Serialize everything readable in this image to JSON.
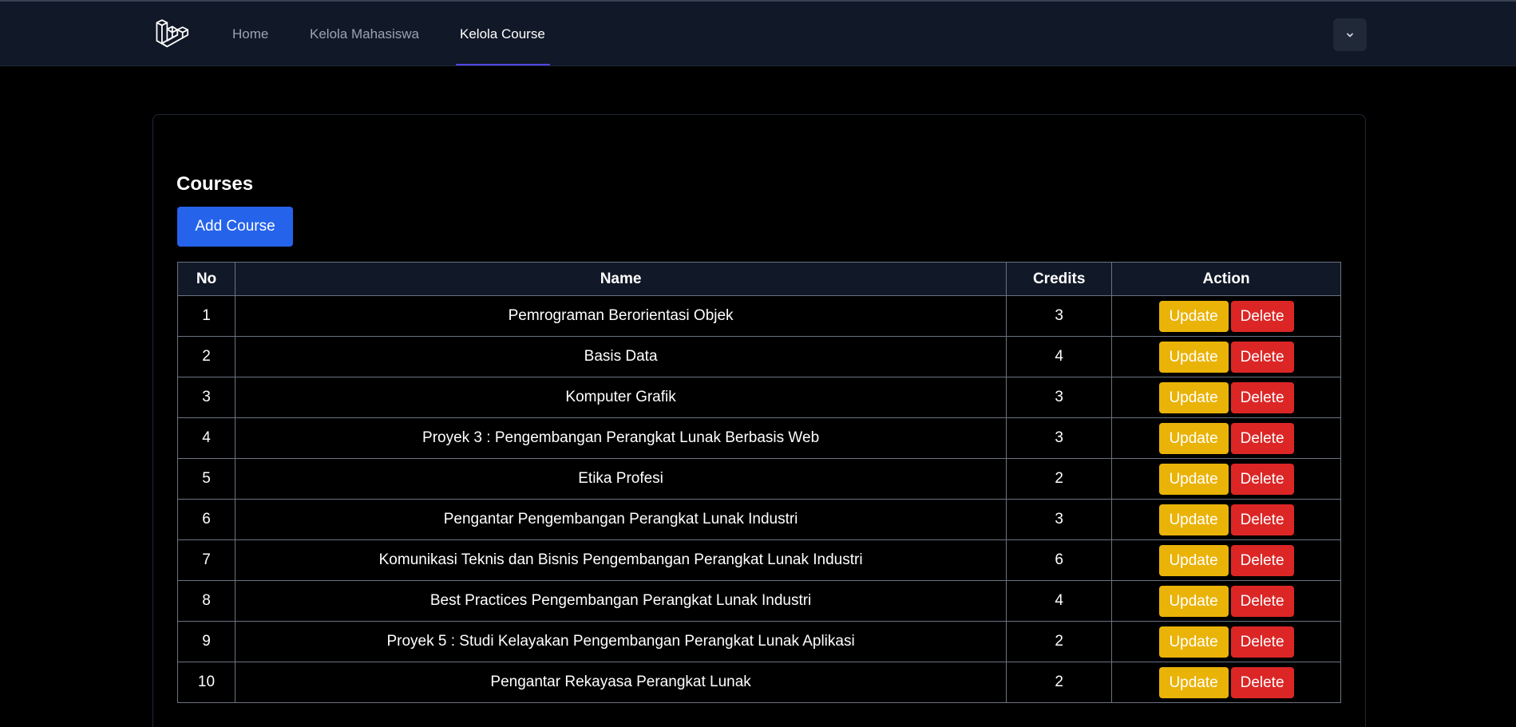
{
  "nav": {
    "logo_icon": "laravel-logo-icon",
    "links": [
      {
        "label": "Home",
        "active": false
      },
      {
        "label": "Kelola Mahasiswa",
        "active": false
      },
      {
        "label": "Kelola Course",
        "active": true
      }
    ],
    "dropdown_icon": "chevron-down-icon",
    "colors": {
      "background": "#111827",
      "active_underline": "#4f46e5"
    }
  },
  "page": {
    "title": "Courses",
    "add_button_label": "Add Course"
  },
  "table": {
    "headers": [
      "No",
      "Name",
      "Credits",
      "Action"
    ],
    "rows": [
      {
        "no": "1",
        "name": "Pemrograman Berorientasi Objek",
        "credits": "3"
      },
      {
        "no": "2",
        "name": "Basis Data",
        "credits": "4"
      },
      {
        "no": "3",
        "name": "Komputer Grafik",
        "credits": "3"
      },
      {
        "no": "4",
        "name": "Proyek 3 : Pengembangan Perangkat Lunak Berbasis Web",
        "credits": "3"
      },
      {
        "no": "5",
        "name": "Etika Profesi",
        "credits": "2"
      },
      {
        "no": "6",
        "name": "Pengantar Pengembangan Perangkat Lunak Industri",
        "credits": "3"
      },
      {
        "no": "7",
        "name": "Komunikasi Teknis dan Bisnis Pengembangan Perangkat Lunak Industri",
        "credits": "6"
      },
      {
        "no": "8",
        "name": "Best Practices Pengembangan Perangkat Lunak Industri",
        "credits": "4"
      },
      {
        "no": "9",
        "name": "Proyek 5 : Studi Kelayakan Pengembangan Perangkat Lunak Aplikasi",
        "credits": "2"
      },
      {
        "no": "10",
        "name": "Pengantar Rekayasa Perangkat Lunak",
        "credits": "2"
      }
    ],
    "actions": {
      "update_label": "Update",
      "delete_label": "Delete"
    },
    "colors": {
      "update": "#eab308",
      "delete": "#dc2626",
      "add": "#2563eb"
    }
  }
}
